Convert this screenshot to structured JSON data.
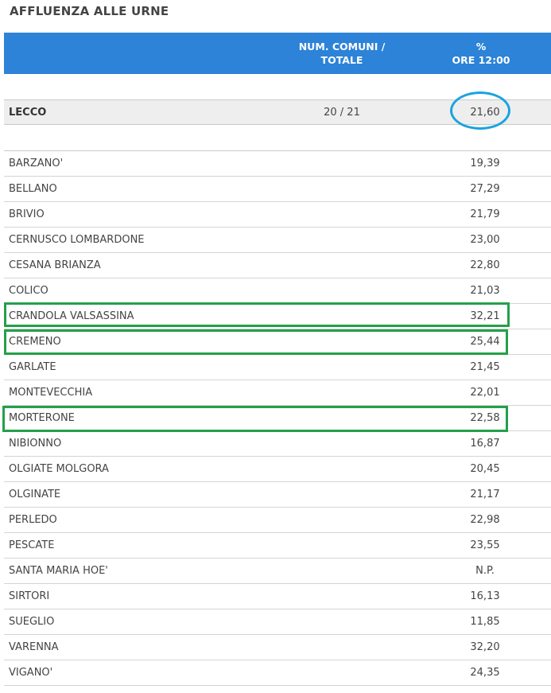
{
  "title": "AFFLUENZA ALLE URNE",
  "header": {
    "col_num_line1": "NUM. COMUNI /",
    "col_num_line2": "TOTALE",
    "col_pct_line1": "%",
    "col_pct_line2": "ORE 12:00"
  },
  "total": {
    "name": "LECCO",
    "count": "20 / 21",
    "value": "21,60"
  },
  "rows": [
    {
      "name": "BARZANO'",
      "value": "19,39"
    },
    {
      "name": "BELLANO",
      "value": "27,29"
    },
    {
      "name": "BRIVIO",
      "value": "21,79"
    },
    {
      "name": "CERNUSCO LOMBARDONE",
      "value": "23,00"
    },
    {
      "name": "CESANA BRIANZA",
      "value": "22,80"
    },
    {
      "name": "COLICO",
      "value": "21,03"
    },
    {
      "name": "CRANDOLA VALSASSINA",
      "value": "32,21"
    },
    {
      "name": "CREMENO",
      "value": "25,44"
    },
    {
      "name": "GARLATE",
      "value": "21,45"
    },
    {
      "name": "MONTEVECCHIA",
      "value": "22,01"
    },
    {
      "name": "MORTERONE",
      "value": "22,58"
    },
    {
      "name": "NIBIONNO",
      "value": "16,87"
    },
    {
      "name": "OLGIATE MOLGORA",
      "value": "20,45"
    },
    {
      "name": "OLGINATE",
      "value": "21,17"
    },
    {
      "name": "PERLEDO",
      "value": "22,98"
    },
    {
      "name": "PESCATE",
      "value": "23,55"
    },
    {
      "name": "SANTA MARIA HOE'",
      "value": "N.P."
    },
    {
      "name": "SIRTORI",
      "value": "16,13"
    },
    {
      "name": "SUEGLIO",
      "value": "11,85"
    },
    {
      "name": "VARENNA",
      "value": "32,20"
    },
    {
      "name": "VIGANO'",
      "value": "24,35"
    }
  ],
  "colors": {
    "header_bg": "#2c83d7",
    "highlight_blue": "#1aa3df",
    "highlight_green": "#24a04a"
  }
}
